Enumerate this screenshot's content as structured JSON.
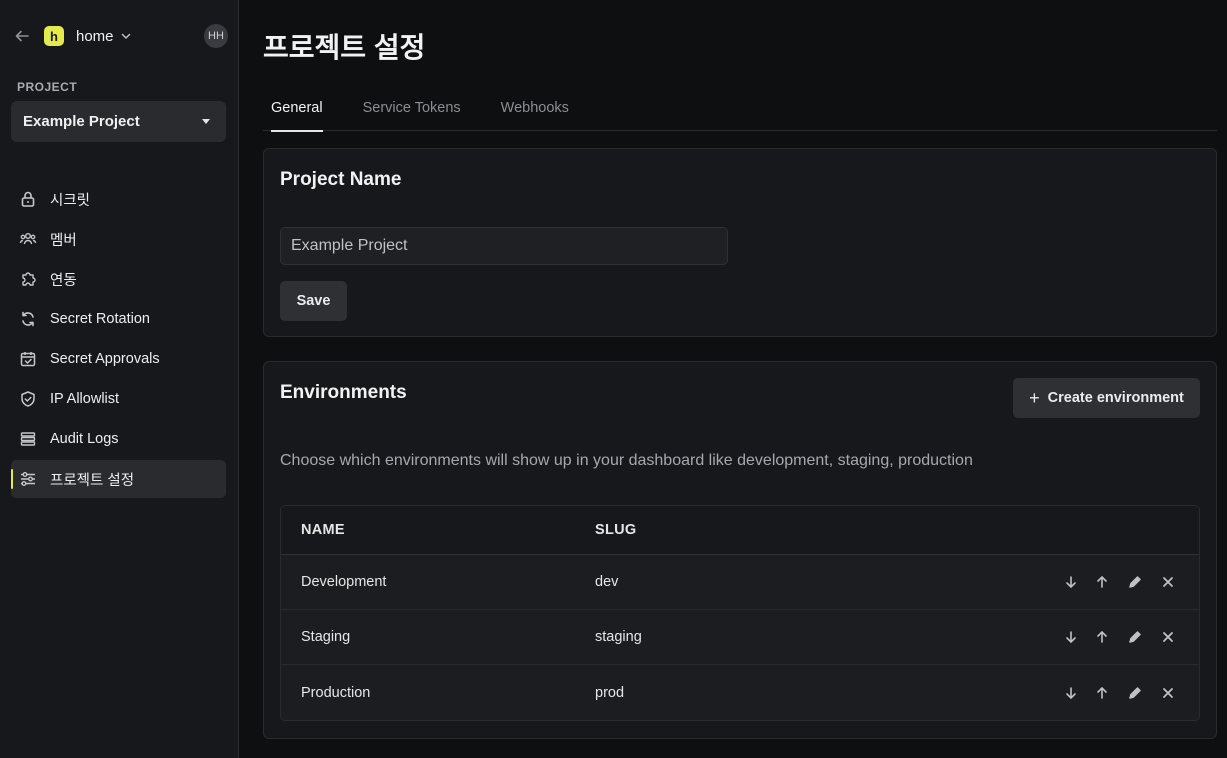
{
  "sidebar": {
    "org": {
      "initial": "h",
      "name": "home"
    },
    "user_initials": "HH",
    "project_label": "PROJECT",
    "project_selected": "Example Project",
    "items": [
      {
        "label": "시크릿",
        "icon": "lock-icon"
      },
      {
        "label": "멤버",
        "icon": "users-icon"
      },
      {
        "label": "연동",
        "icon": "puzzle-icon"
      },
      {
        "label": "Secret Rotation",
        "icon": "rotate-icon"
      },
      {
        "label": "Secret Approvals",
        "icon": "calendar-check-icon"
      },
      {
        "label": "IP Allowlist",
        "icon": "shield-check-icon"
      },
      {
        "label": "Audit Logs",
        "icon": "list-icon"
      },
      {
        "label": "프로젝트 설정",
        "icon": "sliders-icon",
        "active": true
      }
    ]
  },
  "main": {
    "title": "프로젝트 설정",
    "tabs": [
      {
        "label": "General",
        "active": true
      },
      {
        "label": "Service Tokens"
      },
      {
        "label": "Webhooks"
      }
    ],
    "project_name": {
      "title": "Project Name",
      "input_value": "Example Project",
      "save_label": "Save"
    },
    "environments": {
      "title": "Environments",
      "create_label": "Create environment",
      "description": "Choose which environments will show up in your dashboard like development, staging, production",
      "columns": [
        "NAME",
        "SLUG"
      ],
      "rows": [
        {
          "name": "Development",
          "slug": "dev"
        },
        {
          "name": "Staging",
          "slug": "staging"
        },
        {
          "name": "Production",
          "slug": "prod"
        }
      ]
    }
  },
  "colors": {
    "accent": "#e5ea4d",
    "background": "#0e0f11",
    "panel": "#17181b"
  }
}
